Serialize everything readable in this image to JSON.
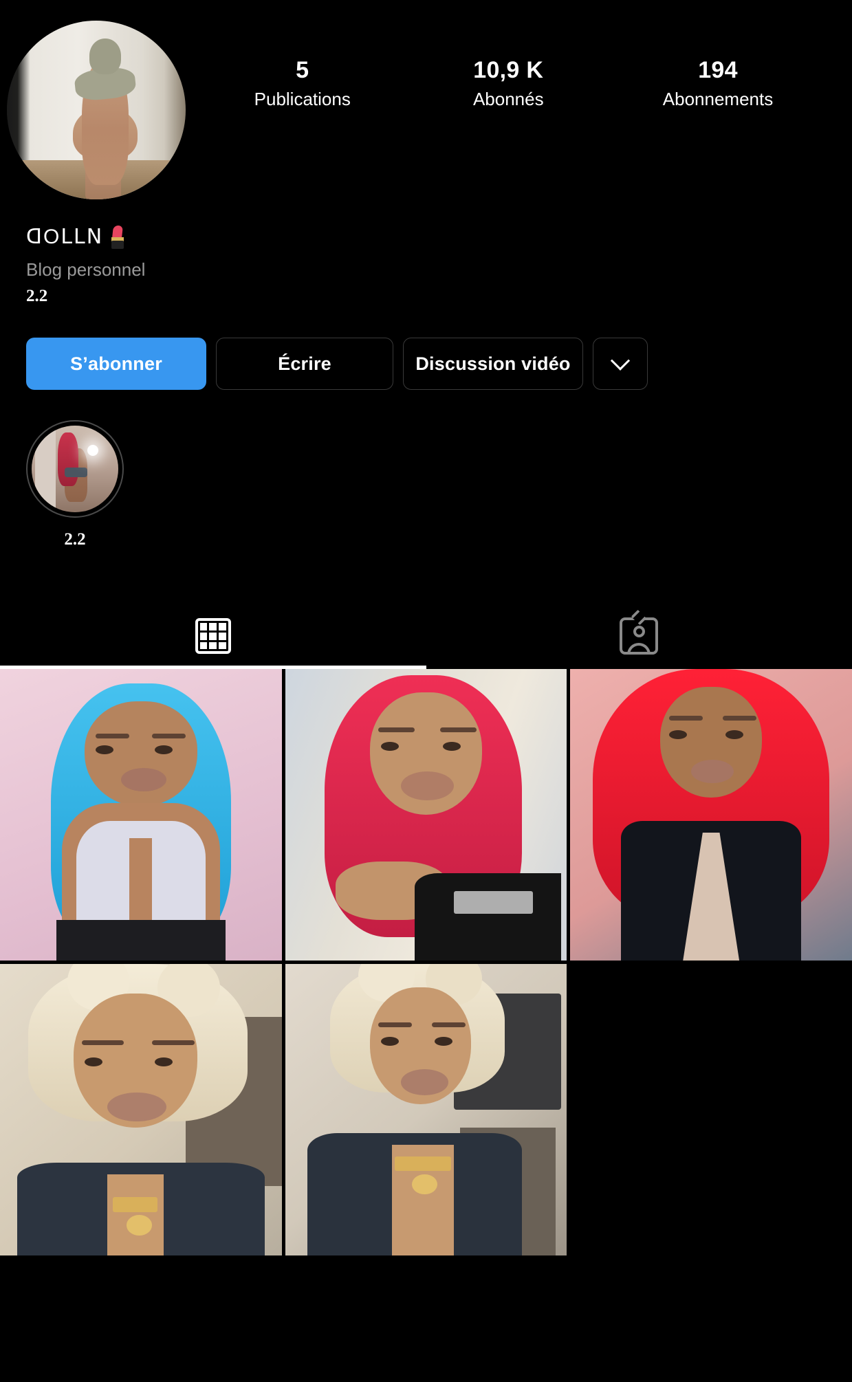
{
  "profile": {
    "avatar_alt": "profile-photo",
    "display_name": "ꓷOᒪᒪꓠ",
    "name_emoji": "lipstick-icon",
    "category": "Blog personnel",
    "bio": "2.2"
  },
  "stats": [
    {
      "value": "5",
      "label": "Publications",
      "name": "posts"
    },
    {
      "value": "10,9 K",
      "label": "Abonnés",
      "name": "followers"
    },
    {
      "value": "194",
      "label": "Abonnements",
      "name": "following"
    }
  ],
  "actions": {
    "follow": "S’abonner",
    "message": "Écrire",
    "video": "Discussion vidéo",
    "more": "chevron-down-icon"
  },
  "highlights": [
    {
      "label": "2.2",
      "name": "story-highlight-2-2"
    }
  ],
  "tabs": [
    {
      "name": "grid-tab",
      "icon": "grid-icon",
      "active": true
    },
    {
      "name": "tagged-tab",
      "icon": "tagged-icon",
      "active": false
    }
  ],
  "posts": [
    {
      "name": "post-blue-hair",
      "bg": "#e9c9d8",
      "hair": "#34b7e8",
      "skin": "#b8845f",
      "top": "#d8d8e4"
    },
    {
      "name": "post-pink-hair-hand",
      "bg": "#d8dde4",
      "hair": "#e0294f",
      "skin": "#c2946b",
      "top": "#151515"
    },
    {
      "name": "post-red-hair-blazer",
      "bg": "#e8a8a8",
      "hair": "#f0223c",
      "skin": "#a9774f",
      "top": "#12151c"
    },
    {
      "name": "post-blonde-bun-1",
      "bg": "#ddd4c4",
      "hair": "#efe6d0",
      "skin": "#c89a6e",
      "top": "#2c3440"
    },
    {
      "name": "post-blonde-bun-2",
      "bg": "#dad4c8",
      "hair": "#ece2cc",
      "skin": "#c79a70",
      "top": "#2a323d"
    },
    {
      "name": "empty-cell",
      "bg": "#000000",
      "hair": "",
      "skin": "",
      "top": ""
    }
  ],
  "colors": {
    "accent": "#3897f0",
    "background": "#000000",
    "text_primary": "#ffffff",
    "text_secondary": "#9a9a9a",
    "border": "#3a3a3a"
  }
}
